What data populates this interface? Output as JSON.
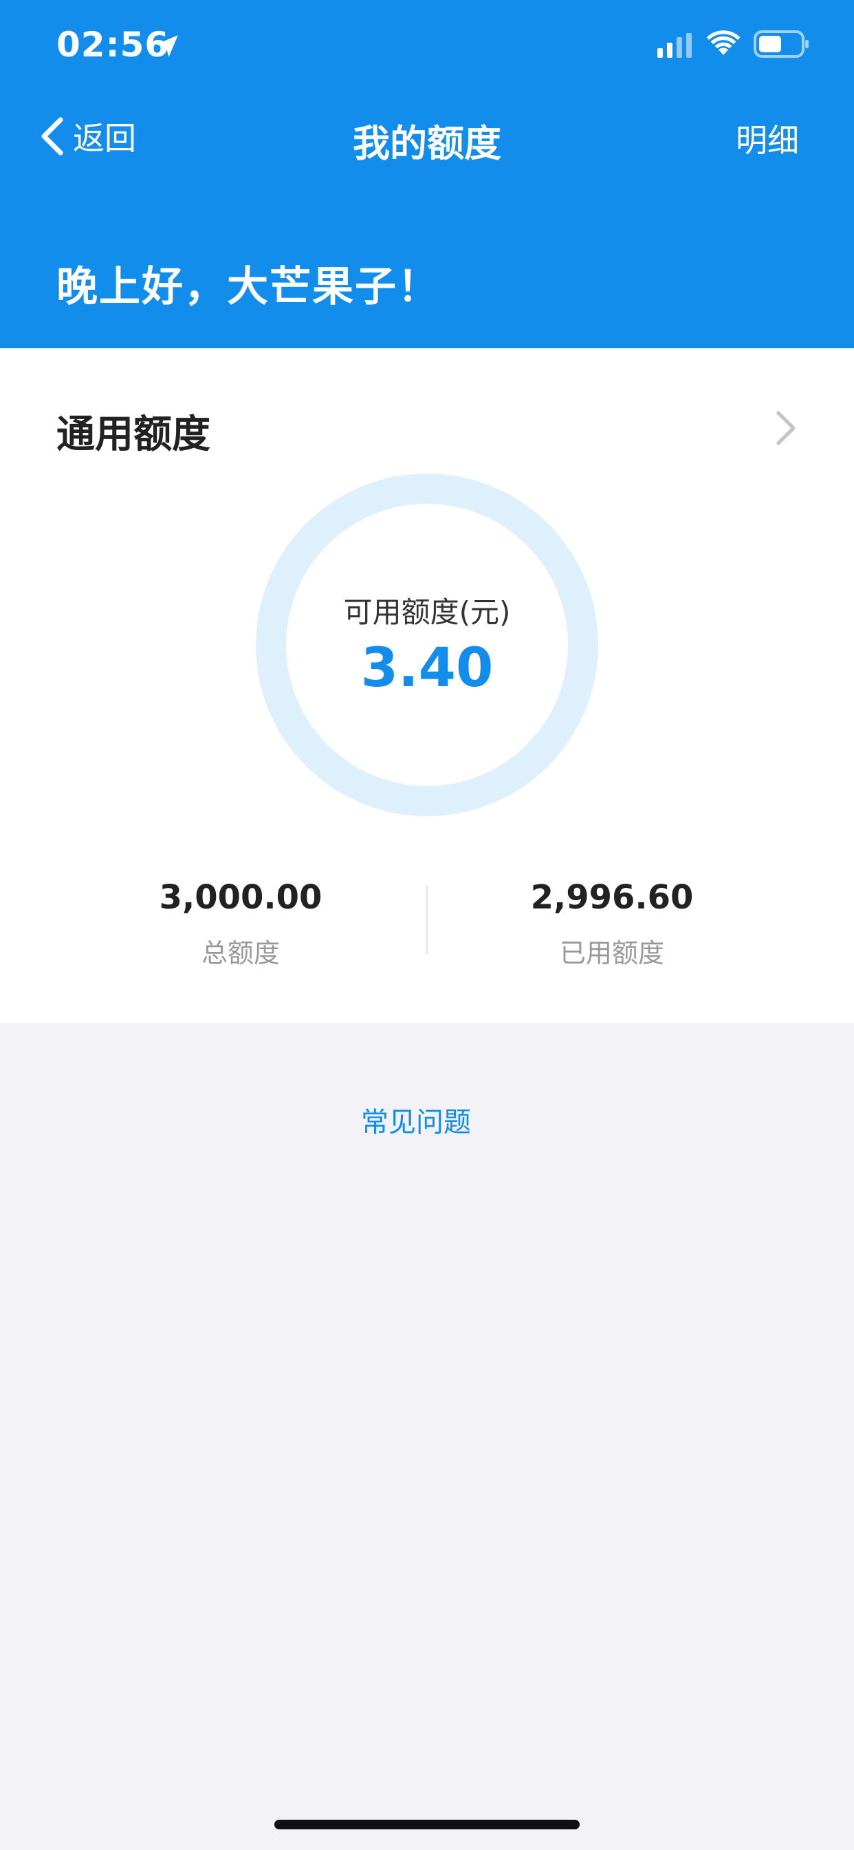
{
  "status_bar": {
    "time": "02:56",
    "icons": [
      "location-arrow-icon",
      "signal-icon",
      "wifi-icon",
      "battery-icon"
    ]
  },
  "nav": {
    "back_label": "返回",
    "title": "我的额度",
    "detail_label": "明细"
  },
  "greeting": "晚上好，大芒果子！",
  "quota_card": {
    "title": "通用额度",
    "available_label": "可用额度(元)",
    "available_value": "3.40",
    "total_value": "3,000.00",
    "total_label": "总额度",
    "used_value": "2,996.60",
    "used_label": "已用额度"
  },
  "faq_label": "常见问题",
  "colors": {
    "accent": "#138deb",
    "ring": "#dff0fd",
    "background": "#f3f3f7",
    "card": "#ffffff"
  }
}
